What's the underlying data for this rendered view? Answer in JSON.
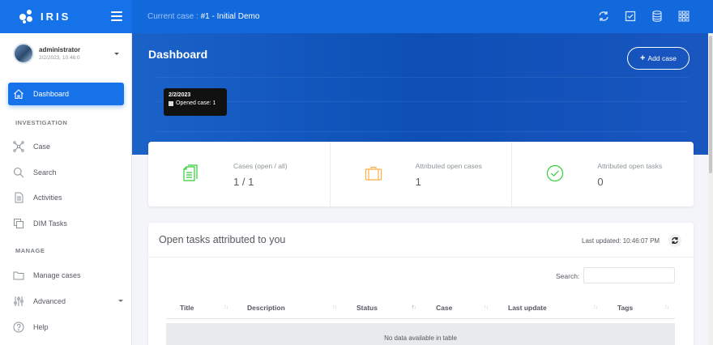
{
  "app": {
    "name": "IRIS"
  },
  "topbar": {
    "case_prefix": "Current case : ",
    "case_name": "#1 - Initial Demo"
  },
  "user": {
    "name": "administrator",
    "date": "2/2/2023, 10:46:0"
  },
  "sidebar": {
    "items": [
      {
        "label": "Dashboard",
        "icon": "home-icon"
      },
      {
        "label": "Case",
        "icon": "case-nodes-icon"
      },
      {
        "label": "Search",
        "icon": "search-icon"
      },
      {
        "label": "Activities",
        "icon": "document-icon"
      },
      {
        "label": "DIM Tasks",
        "icon": "copy-icon"
      },
      {
        "label": "Manage cases",
        "icon": "folder-icon"
      },
      {
        "label": "Advanced",
        "icon": "sliders-icon"
      },
      {
        "label": "Help",
        "icon": "help-icon"
      }
    ],
    "sections": [
      "INVESTIGATION",
      "MANAGE"
    ]
  },
  "dashboard": {
    "title": "Dashboard",
    "add_case": "Add case",
    "tooltip": {
      "date": "2/2/2023",
      "label": "Opened case: 1"
    }
  },
  "stats": [
    {
      "label": "Cases (open / all)",
      "value": "1 / 1",
      "icon": "cases-file-icon",
      "color": "#31ce36"
    },
    {
      "label": "Attributed open cases",
      "value": "1",
      "icon": "briefcase-icon",
      "color": "#ffad46"
    },
    {
      "label": "Attributed open tasks",
      "value": "0",
      "icon": "check-circle-icon",
      "color": "#31ce36"
    }
  ],
  "tasks": {
    "title": "Open tasks attributed to you",
    "last_updated": "Last updated: 10:46:07 PM",
    "search_label": "Search:",
    "columns": [
      "Title",
      "Description",
      "Status",
      "Case",
      "Last update",
      "Tags"
    ],
    "empty": "No data available in table"
  },
  "colors": {
    "primary": "#1572e8",
    "topbar": "#1269db",
    "success": "#31ce36",
    "warning": "#ffad46"
  }
}
